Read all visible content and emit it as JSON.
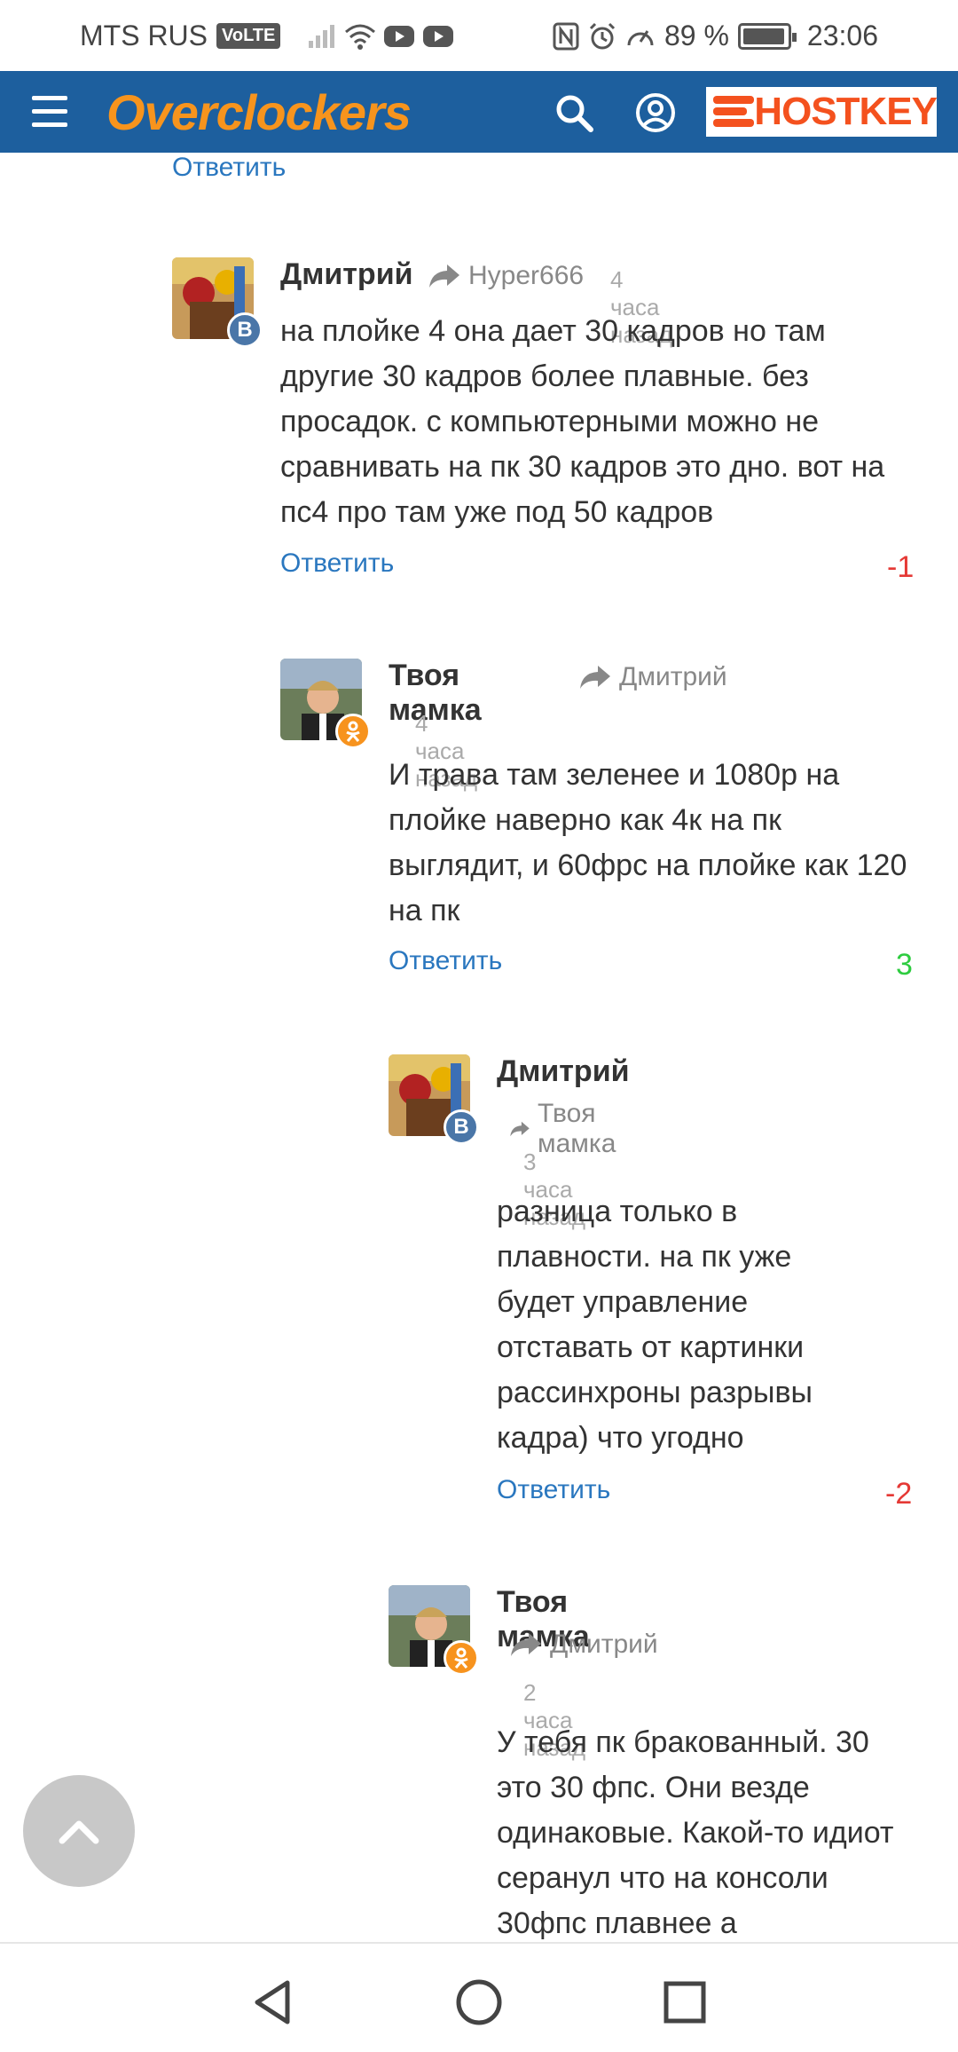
{
  "status_bar": {
    "carrier": "MTS RUS",
    "volte": "VoLTE",
    "battery": "89 %",
    "time": "23:06"
  },
  "header": {
    "logo": "Overclockers",
    "ad_brand": "HOSTKEY"
  },
  "top_reply_label": "Ответить",
  "comments": [
    {
      "author": "Дмитрий",
      "reply_to": "Hyper666",
      "time": "4 часа назад",
      "network": "vk",
      "badge": "В",
      "text": "на плойке 4  она дает 30 кадров  но там другие 30 кадров более плавные. без просадок. с компьютерными можно не сравнивать  на пк 30 кадров это дно. вот на пс4 про там уже под 50 кадров",
      "reply_label": "Ответить",
      "rating": "-1"
    },
    {
      "author": "Твоя мамка",
      "reply_to": "Дмитрий",
      "time": "4 часа назад",
      "network": "ok",
      "badge": "ok",
      "text": "И трава там зеленее и 1080р на плойке наверно как 4к на пк выглядит, и 60фрс на плойке как 120 на пк",
      "reply_label": "Ответить",
      "rating": "3"
    },
    {
      "author": "Дмитрий",
      "reply_to": "Твоя мамка",
      "time": "3 часа назад",
      "network": "vk",
      "badge": "В",
      "text": "разница только в плавности.   на пк уже будет управление отставать от картинки рассинхроны разрывы кадра) что угодно",
      "reply_label": "Ответить",
      "rating": "-2"
    },
    {
      "author": "Твоя мамка",
      "reply_to": "Дмитрий",
      "time": "2 часа назад",
      "network": "ok",
      "badge": "ok",
      "text": "У тебя пк бракованный. 30 это 30 фпс. Они везде одинаковые. Какой-то идиот серанул что на консоли 30фпс плавнее а"
    }
  ],
  "icons": {
    "menu": "hamburger-icon",
    "search": "search-icon",
    "account": "user-circle-icon",
    "reply": "reply-arrow-icon",
    "scroll_top": "chevron-up-icon",
    "back": "back-triangle-icon",
    "home": "home-circle-icon",
    "recents": "recents-square-icon"
  },
  "colors": {
    "header_bg": "#1d5f9e",
    "logo": "#f7941d",
    "link": "#2a77bf",
    "negative": "#e53935",
    "positive": "#2ecc40",
    "vk": "#4a76a8",
    "ok": "#f7931e"
  }
}
